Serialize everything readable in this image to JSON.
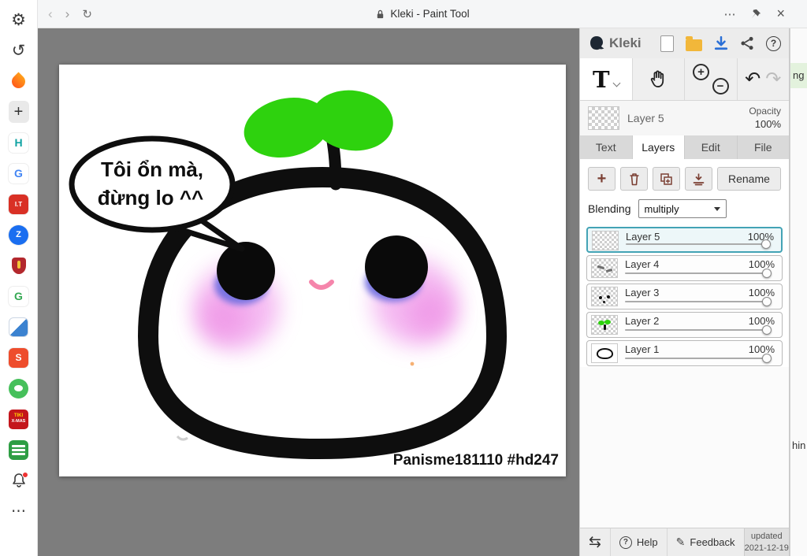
{
  "colors": {
    "accent_teal": "#43a3b5",
    "download_blue": "#2a6fd6",
    "leaf_green": "#2ed20e",
    "canvas_gray": "#7d7d7d",
    "shopee_orange": "#ee4d2d"
  },
  "icons": {
    "back": "‹",
    "forward": "›",
    "reload": "↻",
    "more": "⋯",
    "close": "×",
    "undo": "↶",
    "redo": "↷",
    "swap": "⇆",
    "pencil": "✎",
    "help_q": "?",
    "zoom_in": "+",
    "zoom_out": "−",
    "dots": "⋯",
    "gear": "⚙",
    "history": "↺",
    "plus": "+"
  },
  "titlebar": {
    "title": "Kleki - Paint Tool"
  },
  "sidebar": {
    "h": "H",
    "g1": "G",
    "it": "I.T",
    "z": "Z",
    "g2": "G",
    "shopee": "S",
    "tiki_line1": "TIKI",
    "tiki_line2": "X-MAS"
  },
  "canvas": {
    "speech_line1": "Tôi ổn mà,",
    "speech_line2": "đừng lo ^^",
    "signature": "Panisme181110 #hd247"
  },
  "panel": {
    "logo": "Kleki",
    "tool_text_label": "T",
    "active_layer": {
      "name": "Layer 5",
      "opacity_label": "Opacity",
      "opacity_value": "100%"
    },
    "tabs": [
      "Text",
      "Layers",
      "Edit",
      "File"
    ],
    "rename_label": "Rename",
    "blending_label": "Blending",
    "blending_value": "multiply",
    "layers": [
      {
        "name": "Layer 5",
        "opacity": "100%"
      },
      {
        "name": "Layer 4",
        "opacity": "100%"
      },
      {
        "name": "Layer 3",
        "opacity": "100%"
      },
      {
        "name": "Layer 2",
        "opacity": "100%"
      },
      {
        "name": "Layer 1",
        "opacity": "100%"
      }
    ],
    "footer": {
      "help": "Help",
      "feedback": "Feedback",
      "updated_line1": "updated",
      "updated_line2": "2021-12-19"
    }
  },
  "edge": {
    "top_fragment": "ng",
    "bottom_fragment": "hin"
  }
}
